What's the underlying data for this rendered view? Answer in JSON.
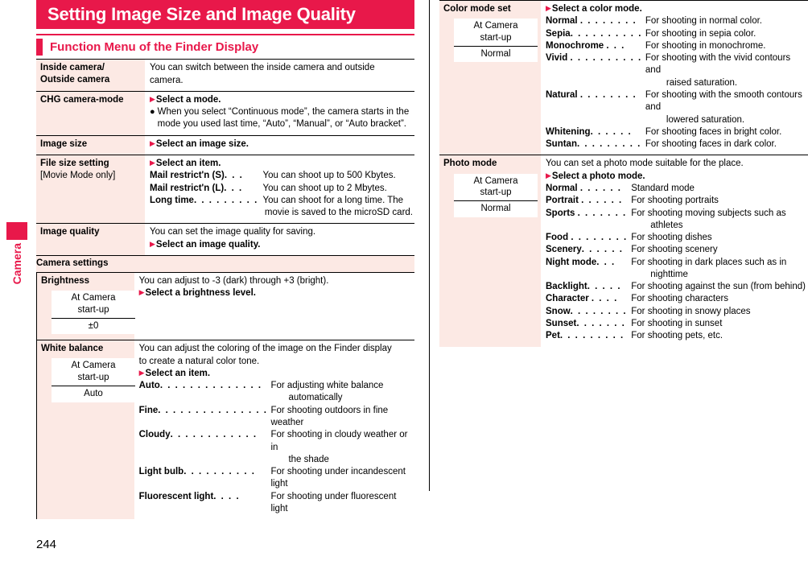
{
  "page": {
    "number": "244",
    "side_tab_label": "Camera",
    "accent_color": "#e8184a",
    "label_bg_color": "#fce9e4"
  },
  "title": "Setting Image Size and Image Quality",
  "section": {
    "heading": "Function Menu of the Finder Display"
  },
  "left_column": {
    "rows": [
      {
        "label": "Inside camera/",
        "label2": "Outside camera",
        "desc_lines": [
          "You can switch between the inside camera and outside",
          "camera."
        ]
      },
      {
        "label": "CHG camera-mode",
        "step": "Select a mode.",
        "bullet": "When you select “Continuous mode”, the camera starts in the mode you used last time, “Auto”, “Manual”, or “Auto bracket”."
      },
      {
        "label": "Image size",
        "step": "Select an image size."
      },
      {
        "label": "File size setting",
        "label_sub": "[Movie Mode only]",
        "step": "Select an item.",
        "defs": [
          {
            "term": "Mail restrict'n (S)",
            "dots": ". . .",
            "desc": "You can shoot up to 500 Kbytes."
          },
          {
            "term": "Mail restrict'n (L)",
            "dots": ". . .",
            "desc": "You can shoot up to 2 Mbytes."
          },
          {
            "term": "Long time",
            "dots": ". . . . . . . . .",
            "desc": "You can shoot for a long time. The",
            "desc2": "movie is saved to the microSD card."
          }
        ]
      },
      {
        "label": "Image quality",
        "intro": "You can set the image quality for saving.",
        "step": "Select an image quality."
      }
    ],
    "group": {
      "header": "Camera settings",
      "items": [
        {
          "label": "Brightness",
          "valbox": {
            "head1": "At Camera",
            "head2": "start-up",
            "value": "±0"
          },
          "intro": "You can adjust to -3 (dark) through +3 (bright).",
          "step": "Select a brightness level."
        },
        {
          "label": "White balance",
          "valbox": {
            "head1": "At Camera",
            "head2": "start-up",
            "value": "Auto"
          },
          "intro_lines": [
            "You can adjust the coloring of the image on the Finder display",
            "to create a natural color tone."
          ],
          "step": "Select an item.",
          "defs": [
            {
              "term": "Auto",
              "dots": ". . . . . . . . . . . . . .",
              "desc": "For adjusting white balance",
              "desc2": "automatically"
            },
            {
              "term": "Fine",
              "dots": ". . . . . . . . . . . . . . .",
              "desc": "For shooting outdoors in fine weather"
            },
            {
              "term": "Cloudy",
              "dots": ". . . . . . . . . . . .",
              "desc": "For shooting in cloudy weather or in",
              "desc2": "the shade"
            },
            {
              "term": "Light bulb",
              "dots": ". . . . . . . . . .",
              "desc": "For shooting under incandescent light"
            },
            {
              "term": "Fluorescent light",
              "dots": ". . . .",
              "desc": "For shooting under fluorescent light"
            }
          ]
        }
      ]
    }
  },
  "right_column": {
    "rows": [
      {
        "label": "Color mode set",
        "valbox": {
          "head1": "At Camera",
          "head2": "start-up",
          "value": "Normal"
        },
        "step": "Select a color mode.",
        "defs": [
          {
            "term": "Normal",
            "dots": ". . . . . . . .",
            "desc": "For shooting in normal color."
          },
          {
            "term": "Sepia",
            "dots": ". . . . . . . . . .",
            "desc": "For shooting in sepia color."
          },
          {
            "term": "Monochrome",
            "dots": ". . .",
            "desc": "For shooting in monochrome."
          },
          {
            "term": "Vivid",
            "dots": ". . . . . . . . . .",
            "desc": "For shooting with the vivid contours and",
            "desc2": "raised saturation."
          },
          {
            "term": "Natural",
            "dots": ". . . . . . . .",
            "desc": "For shooting with the smooth contours and",
            "desc2": "lowered saturation."
          },
          {
            "term": "Whitening",
            "dots": ". . . . . .",
            "desc": "For shooting faces in bright color."
          },
          {
            "term": "Suntan",
            "dots": ". . . . . . . . .",
            "desc": "For shooting faces in dark color."
          }
        ]
      },
      {
        "label": "Photo mode",
        "valbox": {
          "head1": "At Camera",
          "head2": "start-up",
          "value": "Normal"
        },
        "intro": "You can set a photo mode suitable for the place.",
        "step": "Select a photo mode.",
        "defs": [
          {
            "term": "Normal",
            "dots": ". . . . . .",
            "desc": "Standard mode"
          },
          {
            "term": "Portrait",
            "dots": ". . . . . .",
            "desc": "For shooting portraits"
          },
          {
            "term": "Sports",
            "dots": ". . . . . . .",
            "desc": "For shooting moving subjects such as",
            "desc2": "athletes"
          },
          {
            "term": "Food",
            "dots": ". . . . . . . .",
            "desc": "For shooting dishes"
          },
          {
            "term": "Scenery",
            "dots": ". . . . . .",
            "desc": "For shooting scenery"
          },
          {
            "term": "Night mode",
            "dots": ". . .",
            "desc": "For shooting in dark places such as in",
            "desc2": "nighttime"
          },
          {
            "term": "Backlight",
            "dots": ". . . . .",
            "desc": "For shooting against the sun (from behind)"
          },
          {
            "term": "Character",
            "dots": ". . . .",
            "desc": "For shooting characters"
          },
          {
            "term": "Snow",
            "dots": ". . . . . . . .",
            "desc": "For shooting in snowy places"
          },
          {
            "term": "Sunset",
            "dots": ". . . . . . .",
            "desc": "For shooting in sunset"
          },
          {
            "term": "Pet",
            "dots": ". . . . . . . . .",
            "desc": "For shooting pets, etc."
          }
        ]
      }
    ]
  }
}
